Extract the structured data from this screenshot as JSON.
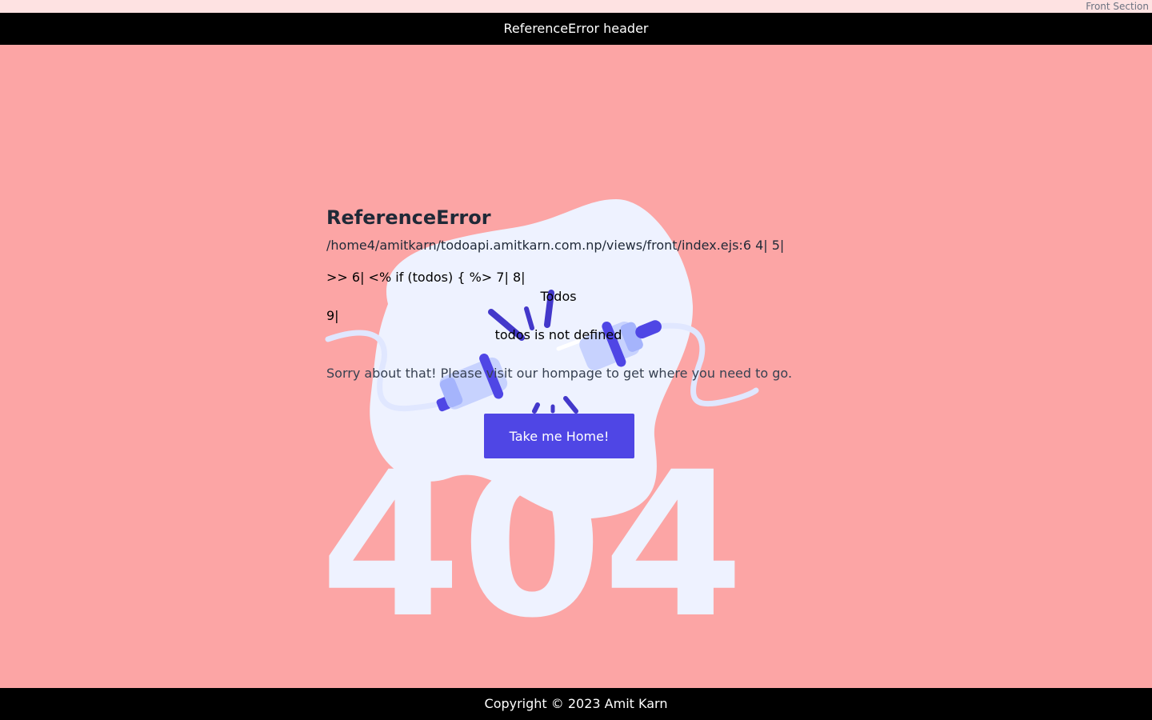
{
  "topbar": {
    "label": "Front Section"
  },
  "header": {
    "title": "ReferenceError header"
  },
  "error": {
    "title": "ReferenceError",
    "path": "/home4/amitkarn/todoapi.amitkarn.com.np/views/front/index.ejs:6 4| 5|",
    "code_line_1": ">> 6| <% if (todos) { %> 7| 8|",
    "todos_heading": "Todos",
    "code_line_2": "9|",
    "message": "todos is not defined"
  },
  "notice": {
    "sorry_text": "Sorry about that! Please visit our hompage to get where you need to go.",
    "home_button": "Take me Home!"
  },
  "illustration": {
    "big_number": "404",
    "icon": "unplugged-cable-icon",
    "colors": {
      "blob": "#eef2ff",
      "plug_light": "#c7d2fe",
      "plug_dark": "#4f46e5"
    }
  },
  "footer": {
    "copyright": "Copyright © 2023 Amit Karn"
  }
}
